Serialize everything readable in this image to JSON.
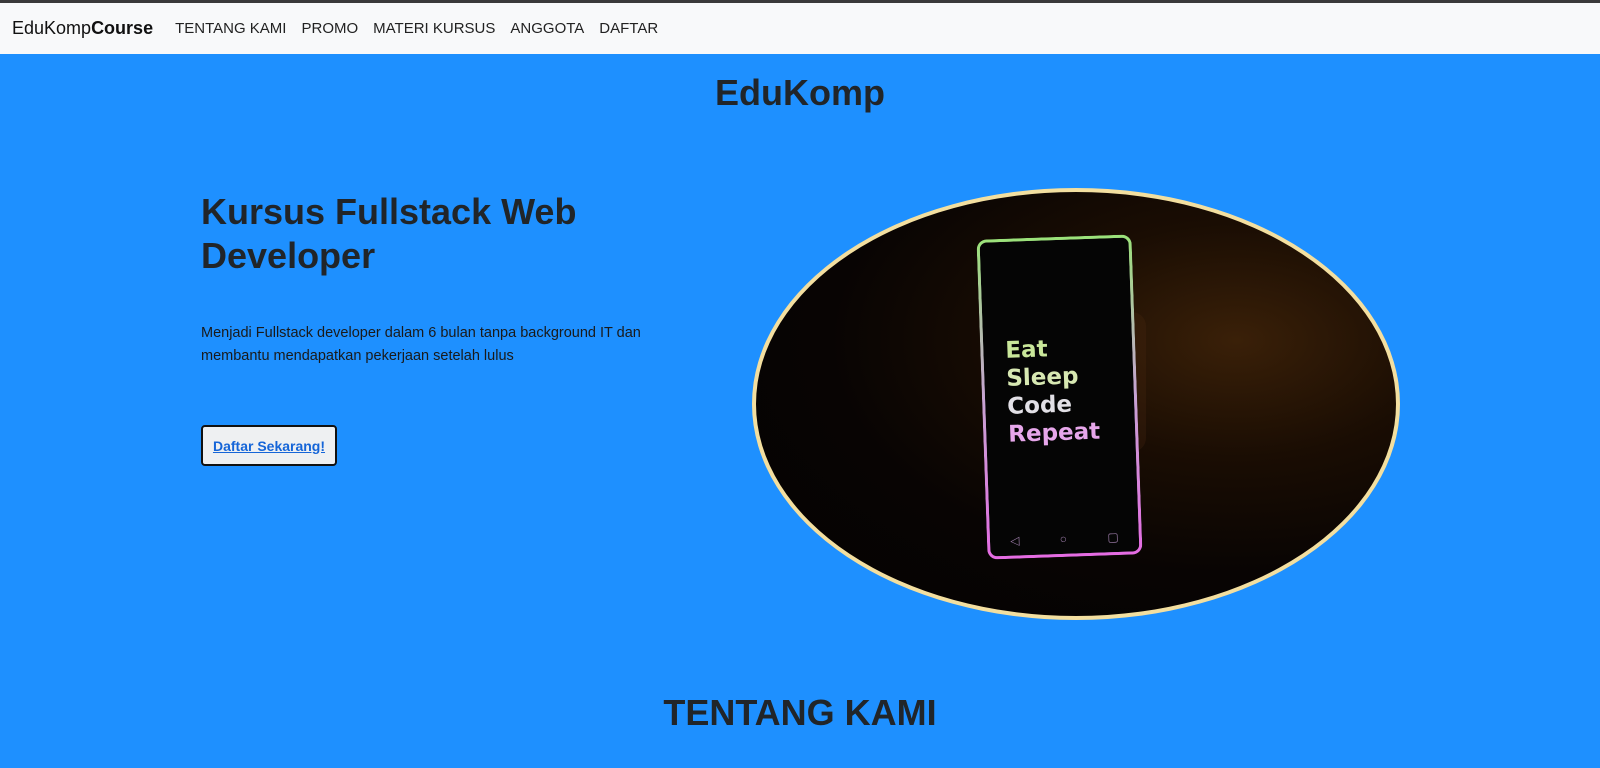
{
  "navbar": {
    "brand_light": "EduKomp",
    "brand_bold": "Course",
    "links": [
      "TENTANG KAMI",
      "PROMO",
      "MATERI KURSUS",
      "ANGGOTA",
      "DAFTAR"
    ]
  },
  "site_title": "EduKomp",
  "hero": {
    "title": "Kursus Fullstack Web Developer",
    "description": "Menjadi Fullstack developer dalam 6 bulan tanpa background IT dan membantu mendapatkan pekerjaan setelah lulus",
    "cta_label": "Daftar Sekarang!",
    "image": {
      "phone_lines": [
        "Eat",
        "Sleep",
        "Code",
        "Repeat"
      ]
    }
  },
  "section_title": "TENTANG KAMI",
  "colors": {
    "background": "#1e90ff",
    "navbar": "#f8f9fa",
    "cta_text": "#1565d8",
    "image_border": "#f3dfa0"
  }
}
